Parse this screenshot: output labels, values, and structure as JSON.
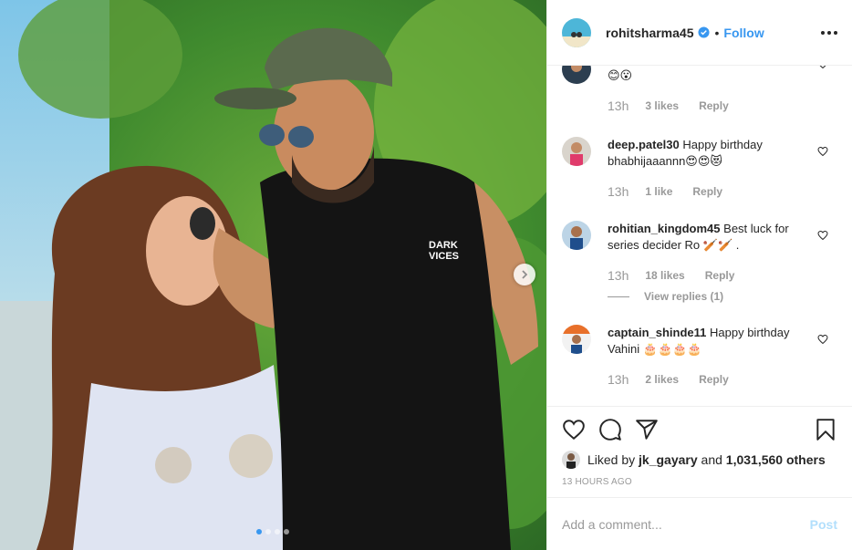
{
  "post": {
    "username": "rohitsharma45",
    "separator": "•",
    "follow_label": "Follow",
    "verified_icon": "verified-badge-icon",
    "more_icon": "more-options-icon",
    "carousel": {
      "slides": 4,
      "active_index": 0
    },
    "caption_print": [
      "DARK",
      "VICES"
    ]
  },
  "comments": [
    {
      "user": "",
      "text": "😊😮",
      "time": "13h",
      "likes": "3 likes",
      "reply": "Reply"
    },
    {
      "user": "deep.patel30",
      "text": "Happy birthday bhabhijaaannn😍😍😻",
      "time": "13h",
      "likes": "1 like",
      "reply": "Reply"
    },
    {
      "user": "rohitian_kingdom45",
      "text": "Best luck for series decider Ro 🏏🏏 .",
      "time": "13h",
      "likes": "18 likes",
      "reply": "Reply",
      "view_replies": "View replies (1)"
    },
    {
      "user": "captain_shinde11",
      "text": "Happy birthday Vahini 🎂🎂🎂🎂",
      "time": "13h",
      "likes": "2 likes",
      "reply": "Reply"
    }
  ],
  "actions": {
    "like_icon": "heart-icon",
    "comment_icon": "comment-icon",
    "share_icon": "share-icon",
    "save_icon": "bookmark-icon"
  },
  "liked_by": {
    "prefix": "Liked by",
    "user": "jk_gayary",
    "conj": "and",
    "count": "1,031,560 others"
  },
  "timestamp": "13 HOURS AGO",
  "add_comment": {
    "placeholder": "Add a comment...",
    "post_label": "Post"
  },
  "colors": {
    "accent": "#3897f0",
    "post_disabled": "#b2dffc",
    "muted": "#999999",
    "text": "#262626"
  }
}
